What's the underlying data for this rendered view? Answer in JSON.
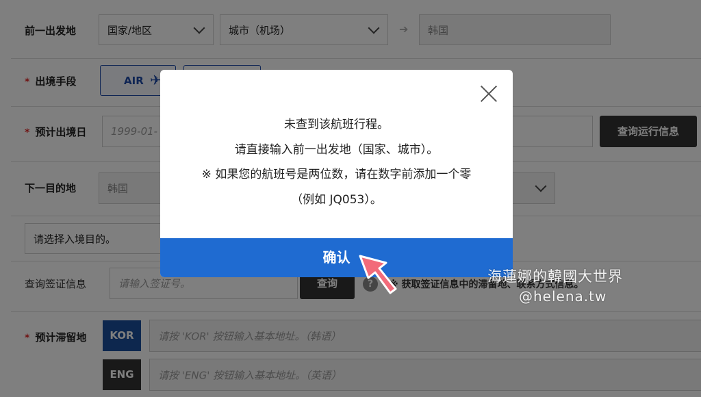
{
  "form": {
    "departure": {
      "label": "前一出发地",
      "country_select": "国家/地区",
      "city_select": "城市（机场）",
      "result_value": "韩国"
    },
    "exit_method": {
      "label": "出境手段",
      "air_option": "AIR"
    },
    "planned_exit": {
      "label": "预计出境日",
      "date_placeholder": "1999-01-",
      "query_button": "查询运行信息"
    },
    "next_destination": {
      "label": "下一目的地",
      "value": "韩国"
    },
    "entry_purpose": {
      "placeholder": "请选择入境目的。"
    },
    "visa_query": {
      "label": "查询签证信息",
      "input_placeholder": "请输入签证号。",
      "query_button": "查询",
      "help_text": "※ 获取签证信息中的滞留地、联系方式信息。"
    },
    "stay_address": {
      "label": "预计滞留地",
      "kor_tag": "KOR",
      "kor_placeholder": "请按 'KOR' 按钮输入基本地址。（韩语）",
      "eng_tag": "ENG",
      "eng_placeholder": "请按 'ENG' 按钮输入基本地址。（英语）"
    },
    "required_mark": "*"
  },
  "modal": {
    "line1": "未查到该航班行程。",
    "line2": "请直接输入前一出发地（国家、城市）。",
    "line3": "※ 如果您的航班号是两位数，请在数字前添加一个零",
    "line4": "（例如 JQ053）。",
    "confirm_button": "确认"
  },
  "watermark": {
    "line1": "海蓮娜的韓國大世界",
    "line2": "@helena.tw"
  },
  "colors": {
    "confirm_blue": "#1f6bd1",
    "air_border": "#1f4aa8",
    "kor_tag": "#1b4f9c",
    "eng_tag": "#333333",
    "arrow_pink": "#f26b7a"
  },
  "icons": {
    "close": "close-icon",
    "arrow": "right-arrow-icon",
    "help": "help-circle-icon",
    "chevron": "chevron-down-icon",
    "plane": "plane-icon"
  }
}
